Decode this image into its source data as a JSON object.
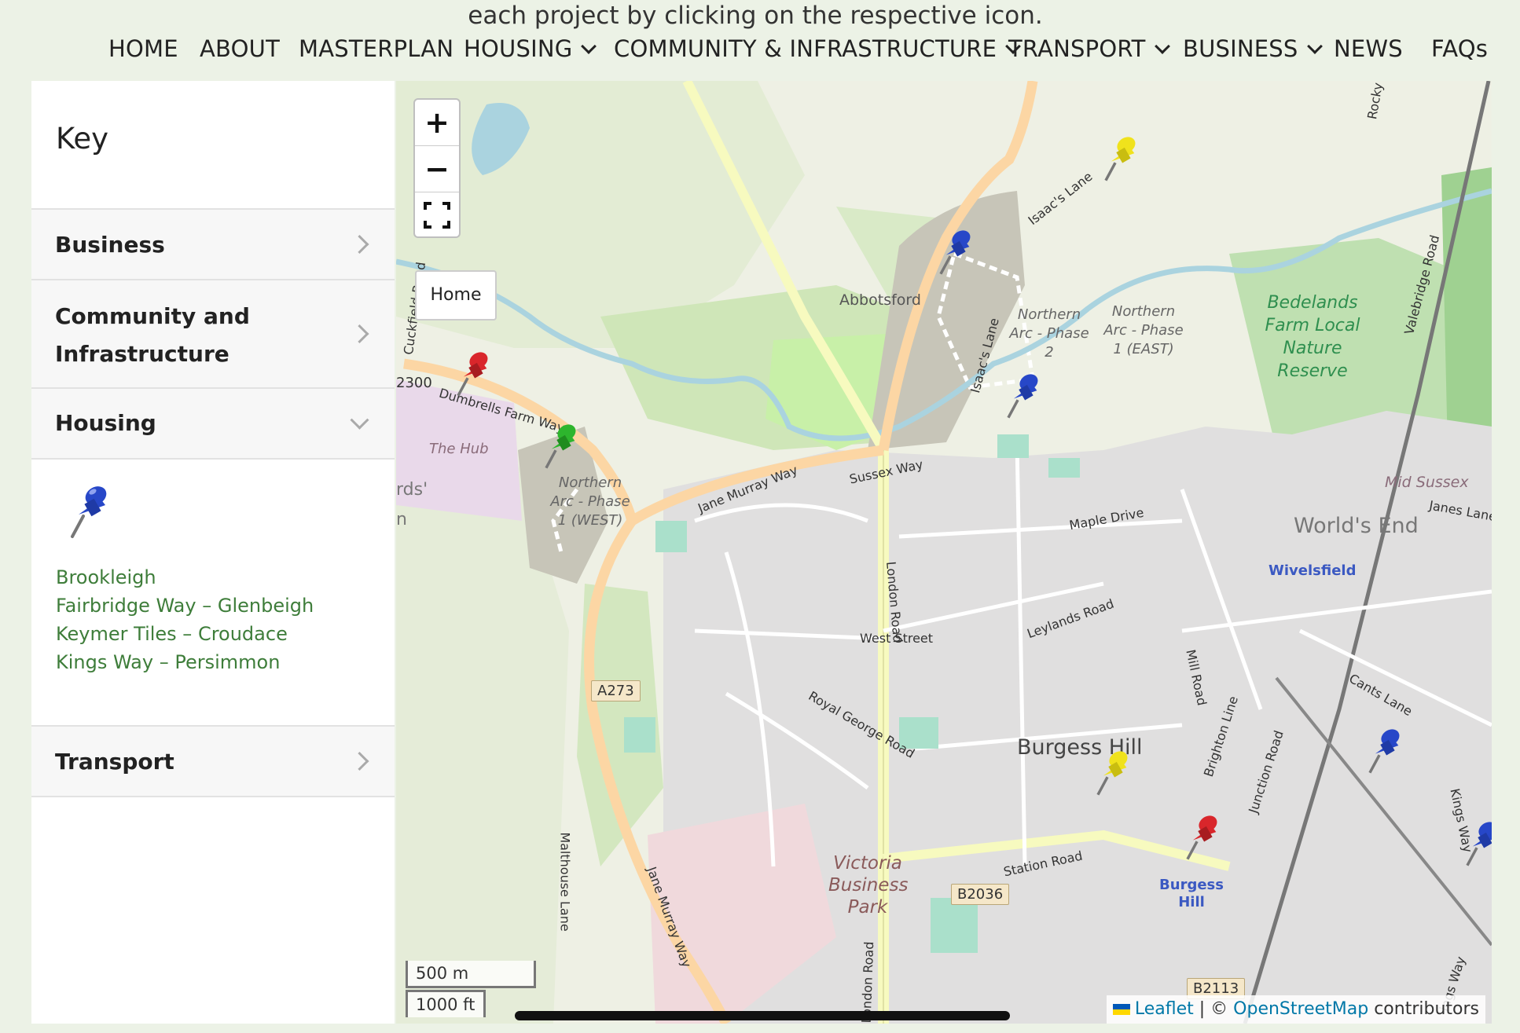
{
  "intro_text": "each project by clicking on the respective icon.",
  "nav": [
    {
      "label": "HOME",
      "dropdown": false
    },
    {
      "label": "ABOUT",
      "dropdown": false
    },
    {
      "label": "MASTERPLAN",
      "dropdown": false
    },
    {
      "label": "HOUSING",
      "dropdown": true
    },
    {
      "label": "COMMUNITY & INFRASTRUCTURE",
      "dropdown": true
    },
    {
      "label": "TRANSPORT",
      "dropdown": true
    },
    {
      "label": "BUSINESS",
      "dropdown": true
    },
    {
      "label": "NEWS",
      "dropdown": false
    },
    {
      "label": "FAQs",
      "dropdown": false
    }
  ],
  "sidebar": {
    "title": "Key",
    "sections": [
      {
        "label": "Business",
        "open": false
      },
      {
        "label": "Community and Infrastructure",
        "open": false
      },
      {
        "label": "Housing",
        "open": true,
        "items": [
          "Brookleigh",
          "Fairbridge Way – Glenbeigh",
          "Keymer Tiles – Croudace",
          "Kings Way – Persimmon"
        ]
      },
      {
        "label": "Transport",
        "open": false
      }
    ],
    "housing_icon": "blue-pushpin-icon"
  },
  "map": {
    "zoom_in": "+",
    "zoom_out": "−",
    "home_label": "Home",
    "scale_metric": "500 m",
    "scale_imperial": "1000 ft",
    "attribution": {
      "leaflet": "Leaflet",
      "separator": " | © ",
      "osm": "OpenStreetMap",
      "suffix": " contributors"
    },
    "labels": {
      "abbotsford": "Abbotsford",
      "burgess_hill": "Burgess Hill",
      "worlds_end": "World's End",
      "mid_sussex": "Mid Sussex",
      "the_hub": "The Hub",
      "victoria": "Victoria Business Park",
      "bedelands": "Bedelands Farm Local Nature Reserve",
      "na_phase2": "Northern Arc - Phase 2",
      "na_phase1_east": "Northern Arc - Phase 1 (EAST)",
      "na_phase1_west": "Northern Arc - Phase 1 (WEST)",
      "wivelsfield": "Wivelsfield",
      "burgess_hill_station": "Burgess Hill",
      "isaacs_lane_1": "Isaac's Lane",
      "isaacs_lane_2": "Isaac's Lane",
      "dumbrells": "Dumbrells Farm Way",
      "jane_murray_1": "Jane Murray Way",
      "jane_murray_2": "Jane Murray Way",
      "sussex_way": "Sussex Way",
      "maple_drive": "Maple Drive",
      "london_road_1": "London Road",
      "london_road_2": "London Road",
      "west_street": "West Street",
      "leylands": "Leylands Road",
      "royal_george": "Royal George Road",
      "mill_road": "Mill Road",
      "station_road": "Station Road",
      "cants_lane": "Cants Lane",
      "janes_lane": "Janes Lane",
      "valebridge": "Valebridge Road",
      "junction_road": "Junction Road",
      "brighton_line": "Brighton Line",
      "kings_way": "Kings Way",
      "malthouse": "Malthouse Lane",
      "cuckfield": "Cuckfield Road",
      "rocky": "Rocky",
      "ings_way": "ings Way",
      "b2300": "2300",
      "rds": "rds'",
      "n": "n"
    },
    "badges": {
      "a273": "A273",
      "b2036": "B2036",
      "b2113": "B2113"
    },
    "marker_colors": {
      "blue": "#2747c8",
      "red": "#d9262b",
      "green": "#2db52d",
      "yellow": "#f0e21c"
    },
    "markers": [
      {
        "color": "yellow",
        "name": "yellow-pushpin-marker"
      },
      {
        "color": "blue",
        "name": "blue-pushpin-marker"
      },
      {
        "color": "blue",
        "name": "blue-pushpin-marker"
      },
      {
        "color": "red",
        "name": "red-pushpin-marker"
      },
      {
        "color": "green",
        "name": "green-pushpin-marker"
      },
      {
        "color": "yellow",
        "name": "yellow-pushpin-marker"
      },
      {
        "color": "red",
        "name": "red-pushpin-marker"
      },
      {
        "color": "blue",
        "name": "blue-pushpin-marker"
      },
      {
        "color": "blue",
        "name": "blue-pushpin-marker"
      }
    ]
  }
}
